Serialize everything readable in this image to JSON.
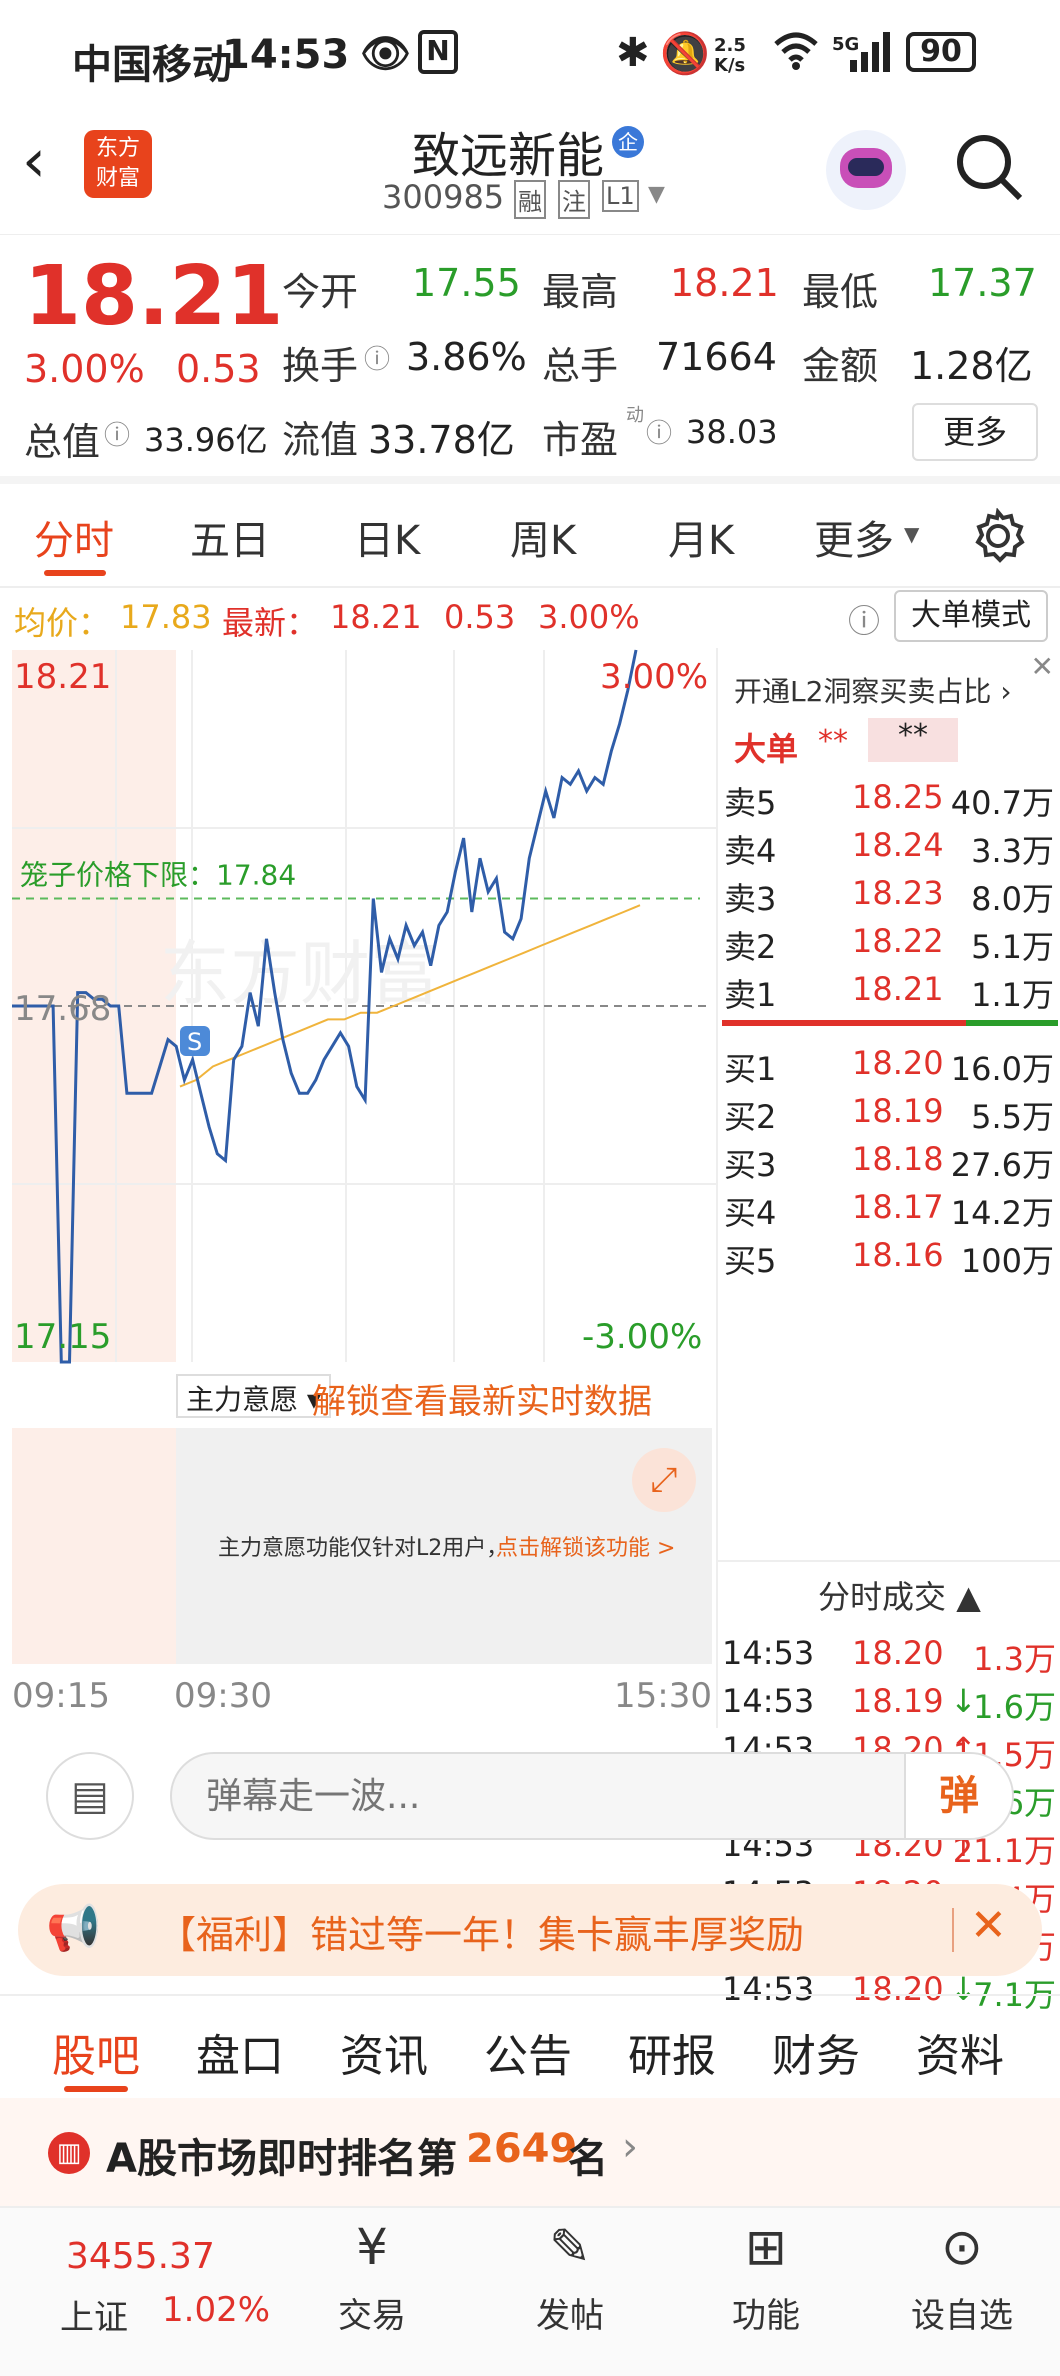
{
  "status": {
    "carrier": "中国移动",
    "time": "14:53",
    "speed_top": "2.5",
    "speed_bottom": "K/s",
    "network": "5G",
    "battery": "90"
  },
  "header": {
    "logo_line1": "东方",
    "logo_line2": "财富",
    "stock_name": "致远新能",
    "badge": "企",
    "code": "300985",
    "tag_margin": "融",
    "tag_follow": "注",
    "tag_level": "L1"
  },
  "quote": {
    "price": "18.21",
    "change_pct": "3.00%",
    "change": "0.53",
    "open_label": "今开",
    "open": "17.55",
    "high_label": "最高",
    "high": "18.21",
    "low_label": "最低",
    "low": "17.37",
    "turnover_label": "换手",
    "turnover": "3.86%",
    "volume_label": "总手",
    "volume": "71664",
    "amount_label": "金额",
    "amount": "1.28亿",
    "mktcap_label": "总值",
    "mktcap": "33.96亿",
    "float_label": "流值",
    "float": "33.78亿",
    "pe_label": "市盈",
    "pe_sup": "动",
    "pe": "38.03",
    "more": "更多"
  },
  "tabs": [
    "分时",
    "五日",
    "日K",
    "周K",
    "月K",
    "更多"
  ],
  "infobar": {
    "avg_label": "均价：",
    "avg": "17.83",
    "latest_label": "最新：",
    "latest": "18.21",
    "chg": "0.53",
    "pct": "3.00%",
    "mode": "大单模式"
  },
  "chart_data": {
    "type": "line",
    "ylim": [
      17.15,
      18.21
    ],
    "y_labels": {
      "top": "18.21",
      "bottom": "17.15",
      "mid": "17.68",
      "top_pct": "3.00%",
      "bottom_pct": "-3.00%"
    },
    "cage_label": "笼子价格下限：17.84",
    "cage_value": 17.84,
    "prev_close": 17.68,
    "x_labels": [
      "09:15",
      "09:30",
      "15:30"
    ],
    "watermark": "东方财富",
    "series": [
      {
        "values": [
          17.68,
          17.68,
          17.68,
          17.68,
          17.68,
          17.68,
          17.15,
          17.15,
          17.7,
          17.7,
          17.69,
          17.69,
          17.68,
          17.68,
          17.55,
          17.55,
          17.55,
          17.55,
          17.59,
          17.63,
          17.62,
          17.57,
          17.6,
          17.55,
          17.5,
          17.46,
          17.45,
          17.6,
          17.62,
          17.7,
          17.65,
          17.78,
          17.7,
          17.63,
          17.58,
          17.55,
          17.55,
          17.57,
          17.6,
          17.62,
          17.64,
          17.62,
          17.56,
          17.54,
          17.84,
          17.73,
          17.78,
          17.75,
          17.8,
          17.77,
          17.79,
          17.74,
          17.8,
          17.82,
          17.88,
          17.93,
          17.82,
          17.9,
          17.85,
          17.87,
          17.79,
          17.78,
          17.81,
          17.9,
          17.95,
          18.0,
          17.96,
          18.02,
          18.01,
          18.03,
          18.0,
          18.02,
          18.01,
          18.06,
          18.1,
          18.15,
          18.21
        ]
      },
      {
        "values": [
          17.56,
          17.57,
          17.59,
          17.6,
          17.61,
          17.62,
          17.63,
          17.64,
          17.65,
          17.66,
          17.66,
          17.67,
          17.67,
          17.68,
          17.69,
          17.7,
          17.71,
          17.72,
          17.73,
          17.74,
          17.75,
          17.76,
          17.77,
          17.78,
          17.79,
          17.8,
          17.81,
          17.82,
          17.83
        ]
      }
    ]
  },
  "chart_extra": {
    "selector": "主力意愿",
    "unlock": "解锁查看最新实时数据",
    "notice": "主力意愿功能仅针对L2用户，",
    "notice_link": "点击解锁该功能 >",
    "s_marker": "S"
  },
  "orderbook": {
    "promo": "开通L2洞察买卖占比",
    "big_label": "大单",
    "big_a": "**",
    "big_b": "**",
    "asks": [
      {
        "l": "卖5",
        "p": "18.25",
        "v": "40.7万"
      },
      {
        "l": "卖4",
        "p": "18.24",
        "v": "3.3万"
      },
      {
        "l": "卖3",
        "p": "18.23",
        "v": "8.0万"
      },
      {
        "l": "卖2",
        "p": "18.22",
        "v": "5.1万"
      },
      {
        "l": "卖1",
        "p": "18.21",
        "v": "1.1万"
      }
    ],
    "bids": [
      {
        "l": "买1",
        "p": "18.20",
        "v": "16.0万"
      },
      {
        "l": "买2",
        "p": "18.19",
        "v": "5.5万"
      },
      {
        "l": "买3",
        "p": "18.18",
        "v": "27.6万"
      },
      {
        "l": "买4",
        "p": "18.17",
        "v": "14.2万"
      },
      {
        "l": "买5",
        "p": "18.16",
        "v": "100万"
      }
    ],
    "ticks_title": "分时成交",
    "ticks": [
      {
        "t": "14:53",
        "p": "18.20",
        "v": "1.3万",
        "d": ""
      },
      {
        "t": "14:53",
        "p": "18.19",
        "v": "1.6万",
        "d": "↓"
      },
      {
        "t": "14:53",
        "p": "18.20",
        "v": "11.5万",
        "d": "↑"
      },
      {
        "t": "14:53",
        "p": "18.19",
        "v": "15.6万",
        "d": "↓"
      },
      {
        "t": "14:53",
        "p": "18.20",
        "v": "21.1万",
        "d": "↑"
      },
      {
        "t": "14:53",
        "p": "18.20",
        "v": "4.4万",
        "d": ""
      },
      {
        "t": "14:53",
        "p": "18.21",
        "v": "4.4万",
        "d": "↑"
      },
      {
        "t": "14:53",
        "p": "18.20",
        "v": "7.1万",
        "d": "↓"
      }
    ]
  },
  "toolbar": {
    "placeholder": "弹幕走一波...",
    "danmu": "弹"
  },
  "banner": {
    "text": "【福利】错过等一年！集卡赢丰厚奖励"
  },
  "subtabs": [
    "股吧",
    "盘口",
    "资讯",
    "公告",
    "研报",
    "财务",
    "资料"
  ],
  "rank": {
    "prefix": "A股市场即时排名第",
    "num": "2649",
    "suffix": "名"
  },
  "bottomnav": {
    "index_value": "3455.37",
    "index_name": "上证",
    "index_pct": "1.02%",
    "items": [
      "交易",
      "发帖",
      "功能",
      "设自选"
    ]
  }
}
